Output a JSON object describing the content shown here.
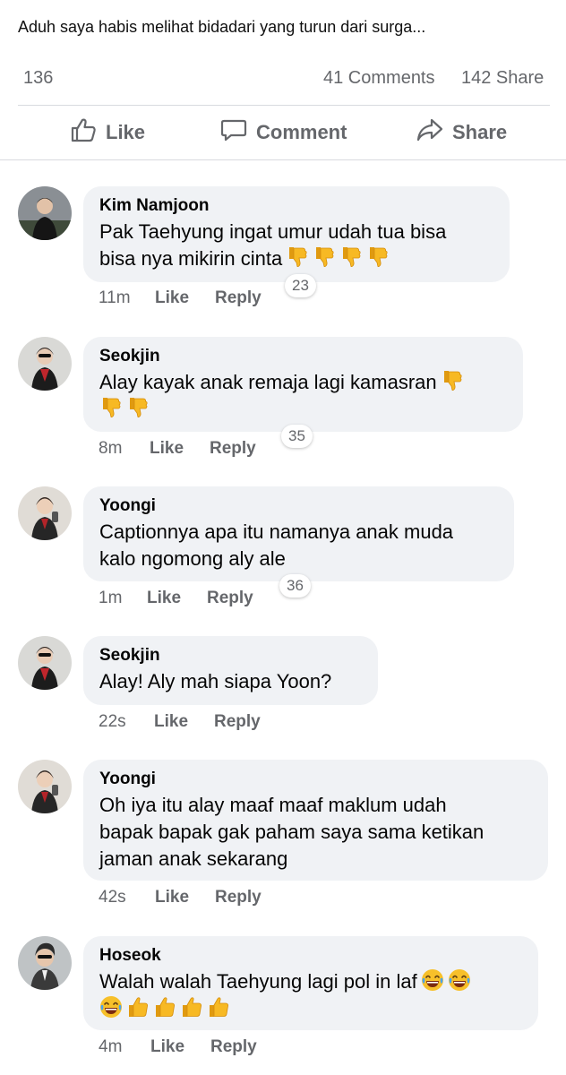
{
  "post": {
    "text": "Aduh saya habis melihat bidadari yang turun dari surga...",
    "reaction_count": "136",
    "comments_count": "41 Comments",
    "share_count": "142 Share"
  },
  "actions": {
    "like": "Like",
    "comment": "Comment",
    "share": "Share"
  },
  "comments": [
    {
      "name": "Kim Namjoon",
      "lines": [
        "Pak Taehyung ingat umur udah tua bisa",
        "bisa nya mikirin cinta"
      ],
      "emoji_line2": [
        "thumbs-down",
        "thumbs-down",
        "thumbs-down",
        "thumbs-down"
      ],
      "time": "11m",
      "like": "Like",
      "reply": "Reply",
      "reactions": "23"
    },
    {
      "name": "Seokjin",
      "lines": [
        "Alay kayak anak remaja lagi kamasran",
        ""
      ],
      "emoji_line1": [
        "thumbs-down"
      ],
      "emoji_line2": [
        "thumbs-down",
        "thumbs-down"
      ],
      "time": "8m",
      "like": "Like",
      "reply": "Reply",
      "reactions": "35"
    },
    {
      "name": "Yoongi",
      "lines": [
        "Captionnya apa itu namanya anak muda",
        "kalo ngomong aly ale"
      ],
      "time": "1m",
      "like": "Like",
      "reply": "Reply",
      "reactions": "36"
    },
    {
      "name": "Seokjin",
      "lines": [
        "Alay! Aly mah siapa Yoon?"
      ],
      "time": "22s",
      "like": "Like",
      "reply": "Reply"
    },
    {
      "name": "Yoongi",
      "lines": [
        "Oh iya itu alay maaf maaf maklum udah",
        "bapak bapak gak paham saya sama ketikan",
        "jaman anak sekarang"
      ],
      "time": "42s",
      "like": "Like",
      "reply": "Reply"
    },
    {
      "name": "Hoseok",
      "lines": [
        "Walah walah Taehyung lagi pol in laf",
        ""
      ],
      "emoji_line1": [
        "laughing",
        "laughing"
      ],
      "emoji_line2": [
        "laughing",
        "thumbs-up",
        "thumbs-up",
        "thumbs-up",
        "thumbs-up"
      ],
      "time": "4m",
      "like": "Like",
      "reply": "Reply"
    }
  ],
  "icons": {
    "like": "thumbs-up-outline-icon",
    "comment": "speech-bubble-icon",
    "share": "share-arrow-icon"
  },
  "colors": {
    "bubble": "#f0f2f5",
    "muted": "#65676b",
    "emoji": "#f5b120"
  }
}
